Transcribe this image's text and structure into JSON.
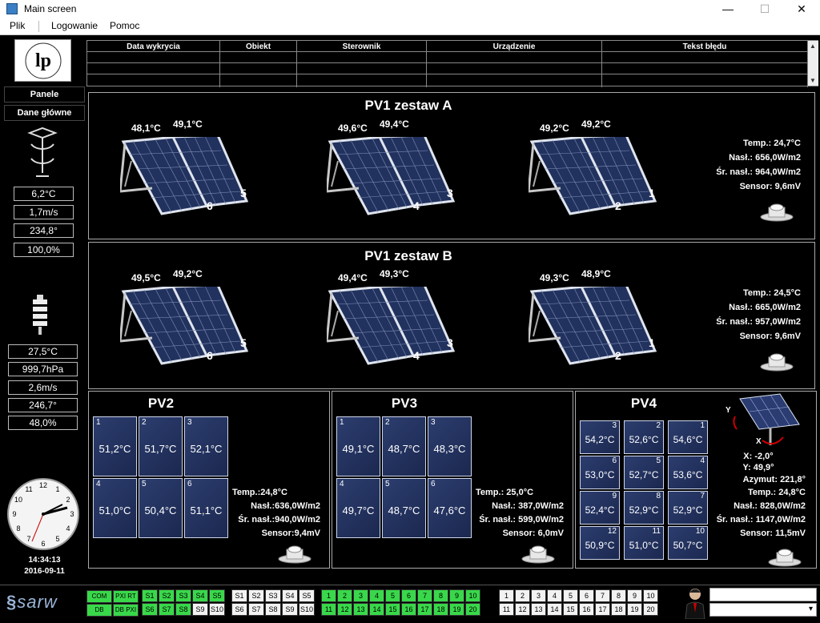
{
  "window": {
    "title": "Main screen",
    "minimize": "—",
    "maximize": "☐",
    "close": "✕"
  },
  "menu": [
    "Plik",
    "Logowanie",
    "Pomoc"
  ],
  "logo": {
    "text": "POLITECHNIKA BIAŁOSTOCKA"
  },
  "sidebar": {
    "panele": "Panele",
    "dane": "Dane główne",
    "wind_values": [
      "6,2°C",
      "1,7m/s",
      "234,8°",
      "100,0%"
    ],
    "station_values": [
      "27,5°C",
      "999,7hPa",
      "2,6m/s",
      "246,7°",
      "48,0%"
    ],
    "clock_time": "14:34:13",
    "clock_date": "2016-09-11"
  },
  "error_table": {
    "headers": [
      "Data wykrycia",
      "Obiekt",
      "Sterownik",
      "Urządzenie",
      "Tekst błędu"
    ]
  },
  "pv1a": {
    "title": "PV1 zestaw A",
    "groups": [
      {
        "t1": "48,1°C",
        "t2": "49,1°C",
        "n1": "6",
        "n2": "5"
      },
      {
        "t1": "49,6°C",
        "t2": "49,4°C",
        "n1": "4",
        "n2": "3"
      },
      {
        "t1": "49,2°C",
        "t2": "49,2°C",
        "n1": "2",
        "n2": "1"
      }
    ],
    "stats": [
      "Temp.: 24,7°C",
      "Nasł.: 656,0W/m2",
      "Śr. nasł.: 964,0W/m2",
      "Sensor: 9,6mV"
    ]
  },
  "pv1b": {
    "title": "PV1 zestaw B",
    "groups": [
      {
        "t1": "49,5°C",
        "t2": "49,2°C",
        "n1": "6",
        "n2": "5"
      },
      {
        "t1": "49,4°C",
        "t2": "49,3°C",
        "n1": "4",
        "n2": "3"
      },
      {
        "t1": "49,3°C",
        "t2": "48,9°C",
        "n1": "2",
        "n2": "1"
      }
    ],
    "stats": [
      "Temp.: 24,5°C",
      "Nasł.: 665,0W/m2",
      "Śr. nasł.: 957,0W/m2",
      "Sensor: 9,6mV"
    ]
  },
  "pv2": {
    "title": "PV2",
    "cells": [
      {
        "n": "1",
        "v": "51,2°C"
      },
      {
        "n": "2",
        "v": "51,7°C"
      },
      {
        "n": "3",
        "v": "52,1°C"
      },
      {
        "n": "4",
        "v": "51,0°C"
      },
      {
        "n": "5",
        "v": "50,4°C"
      },
      {
        "n": "6",
        "v": "51,1°C"
      }
    ],
    "stats": [
      "Temp.:24,8°C",
      "Nasł.:636,0W/m2",
      "Śr. nasł.:940,0W/m2",
      "Sensor:9,4mV"
    ]
  },
  "pv3": {
    "title": "PV3",
    "cells": [
      {
        "n": "1",
        "v": "49,1°C"
      },
      {
        "n": "2",
        "v": "48,7°C"
      },
      {
        "n": "3",
        "v": "48,3°C"
      },
      {
        "n": "4",
        "v": "49,7°C"
      },
      {
        "n": "5",
        "v": "48,7°C"
      },
      {
        "n": "6",
        "v": "47,6°C"
      }
    ],
    "stats": [
      "Temp.: 25,0°C",
      "Nasł.: 387,0W/m2",
      "Śr. nasł.: 599,0W/m2",
      "Sensor: 6,0mV"
    ]
  },
  "pv4": {
    "title": "PV4",
    "cells": [
      {
        "n": "3",
        "v": "54,2°C"
      },
      {
        "n": "2",
        "v": "52,6°C"
      },
      {
        "n": "1",
        "v": "54,6°C"
      },
      {
        "n": "6",
        "v": "53,0°C"
      },
      {
        "n": "5",
        "v": "52,7°C"
      },
      {
        "n": "4",
        "v": "53,6°C"
      },
      {
        "n": "9",
        "v": "52,4°C"
      },
      {
        "n": "8",
        "v": "52,9°C"
      },
      {
        "n": "7",
        "v": "52,9°C"
      },
      {
        "n": "12",
        "v": "50,9°C"
      },
      {
        "n": "11",
        "v": "51,0°C"
      },
      {
        "n": "10",
        "v": "50,7°C"
      }
    ],
    "tracker": {
      "y_label": "Y",
      "x_label": "X"
    },
    "stats": [
      "X: -2,0°",
      "Y: 49,9°",
      "Azymut: 221,8°",
      "Temp.: 24,8°C",
      "Nasł.: 828,0W/m2",
      "Śr. nasł.: 1147,0W/m2",
      "Sensor: 11,5mV"
    ]
  },
  "bottom": {
    "brand": "sarw",
    "com": "COM",
    "db": "DB",
    "pxi_rt": "PXI RT",
    "db_pxi": "DB PXI",
    "s_row1": [
      "S1",
      "S2",
      "S3",
      "S4",
      "S5"
    ],
    "s_row2": [
      "S6",
      "S7",
      "S8",
      "S9",
      "S10"
    ],
    "green_s_count_row1": 5,
    "green_s_count_row2": 3,
    "n_row1": [
      "1",
      "2",
      "3",
      "4",
      "5",
      "6",
      "7",
      "8",
      "9",
      "10"
    ],
    "n_row2": [
      "11",
      "12",
      "13",
      "14",
      "15",
      "16",
      "17",
      "18",
      "19",
      "20"
    ]
  }
}
